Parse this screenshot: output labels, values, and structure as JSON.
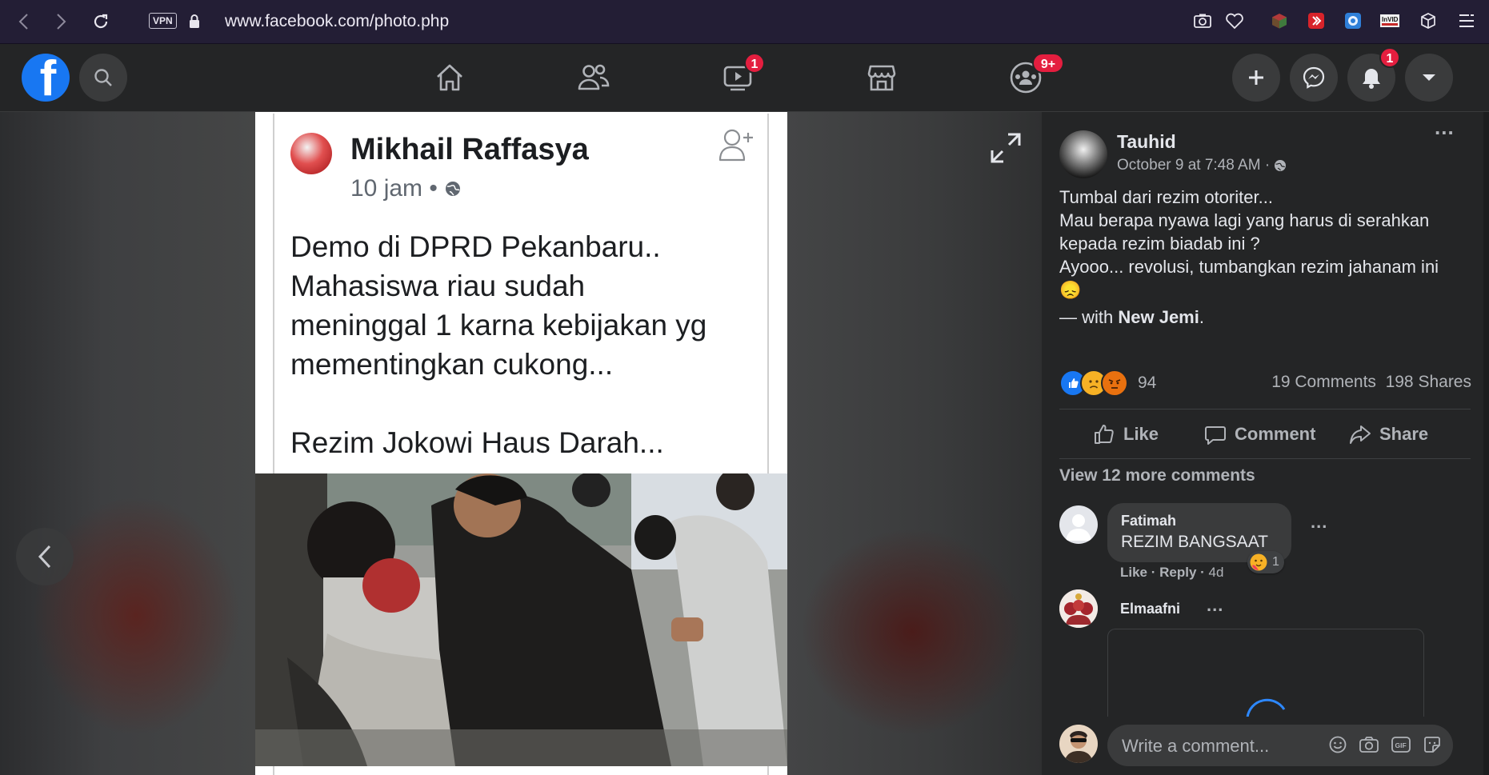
{
  "browser": {
    "vpn_label": "VPN",
    "url": "www.facebook.com/photo.php"
  },
  "nav": {
    "watch_badge": "1",
    "groups_badge": "9+",
    "notifications_badge": "1"
  },
  "photo_post": {
    "author": "Mikhail Raffasya",
    "time": "10 jam •",
    "text_lines": [
      "Demo di DPRD Pekanbaru..",
      "Mahasiswa riau sudah",
      "meninggal 1 karna kebijakan yg",
      "mementingkan cukong...",
      "",
      "Rezim Jokowi Haus Darah..."
    ]
  },
  "post": {
    "author": "Tauhid",
    "date": "October 9 at 7:48 AM ·",
    "lines": [
      "Tumbal dari rezim otoriter...",
      "Mau berapa nyawa lagi yang harus di serahkan kepada rezim biadab ini ?",
      "Ayooo... revolusi, tumbangkan rezim jahanam ini"
    ],
    "emoji": "😞",
    "with_prefix": "— with ",
    "with_name": "New Jemi",
    "with_suffix": ".",
    "reaction_count": "94",
    "comments_count": "19 Comments",
    "shares_count": "198 Shares"
  },
  "actions": {
    "like": "Like",
    "comment": "Comment",
    "share": "Share"
  },
  "view_more": "View 12 more comments",
  "comments": [
    {
      "author": "Fatimah",
      "text": "REZIM BANGSAAT",
      "like": "Like",
      "reply": "Reply",
      "age": "4d",
      "reaction_count": "1"
    },
    {
      "author": "Elmaafni"
    }
  ],
  "composer": {
    "placeholder": "Write a comment..."
  },
  "colors": {
    "fb_blue": "#1877f2",
    "badge_red": "#e41e3f",
    "panel_bg": "#242526",
    "browser_bg": "#231e35"
  },
  "icons": [
    "back-icon",
    "forward-icon",
    "reload-icon",
    "lock-icon",
    "camera-icon",
    "heart-icon",
    "home-icon",
    "friends-icon",
    "watch-icon",
    "marketplace-icon",
    "groups-icon",
    "plus-icon",
    "messenger-icon",
    "bell-icon",
    "caret-icon",
    "expand-icon",
    "globe-icon",
    "like-icon",
    "comment-icon",
    "share-icon",
    "emoji-icon",
    "gif-icon",
    "sticker-icon"
  ]
}
